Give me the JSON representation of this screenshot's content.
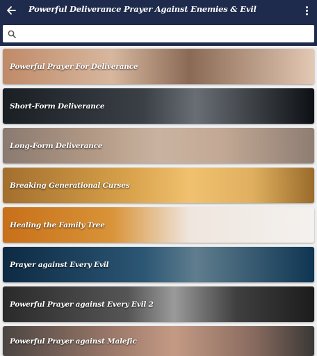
{
  "header": {
    "title": "Powerful Deliverance Prayer Against Enemies & Evil",
    "back_icon": "arrow-left-icon",
    "more_icon": "more-vertical-icon"
  },
  "search": {
    "icon": "search-icon",
    "placeholder": "",
    "value": ""
  },
  "colors": {
    "appbar": "#1f2b4d",
    "text": "#ffffff"
  },
  "items": [
    {
      "label": "Powerful Prayer For Deliverance"
    },
    {
      "label": "Short-Form Deliverance"
    },
    {
      "label": "Long-Form Deliverance"
    },
    {
      "label": "Breaking Generational Curses"
    },
    {
      "label": "Healing the Family Tree"
    },
    {
      "label": "Prayer against Every Evil"
    },
    {
      "label": "Powerful Prayer against Every Evil 2"
    },
    {
      "label": "Powerful Prayer against Malefic"
    }
  ]
}
